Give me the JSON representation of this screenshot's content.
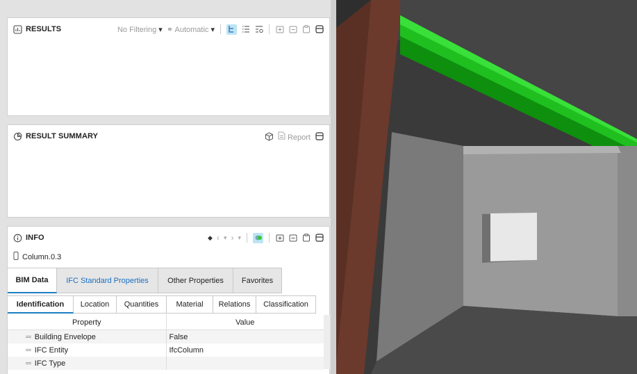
{
  "results": {
    "title": "RESULTS",
    "filter": "No Filtering",
    "mode": "Automatic"
  },
  "summary": {
    "title": "RESULT SUMMARY",
    "report": "Report"
  },
  "info": {
    "title": "INFO",
    "element": "Column.0.3",
    "tabs": [
      "BIM Data",
      "IFC Standard Properties",
      "Other Properties",
      "Favorites"
    ],
    "subtabs": [
      "Identification",
      "Location",
      "Quantities",
      "Material",
      "Relations",
      "Classification"
    ],
    "columns": {
      "property": "Property",
      "value": "Value"
    },
    "rows": [
      {
        "property": "Building Envelope",
        "value": "False"
      },
      {
        "property": "IFC Entity",
        "value": "IfcColumn"
      },
      {
        "property": "IFC Type",
        "value": ""
      }
    ]
  },
  "colors": {
    "accent": "#1a7fc1",
    "beam": "#22cc22",
    "column": "#6b3a2c"
  }
}
